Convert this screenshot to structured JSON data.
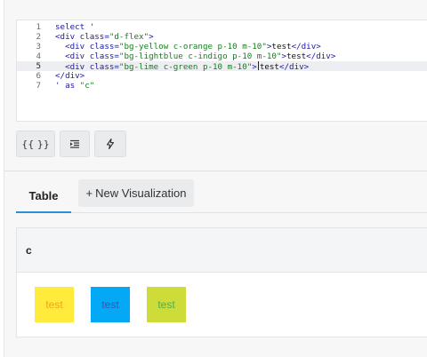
{
  "editor": {
    "lines": [
      {
        "num": "1",
        "parts": [
          {
            "c": "",
            "text": "select '"
          }
        ]
      },
      {
        "num": "2",
        "parts": [
          {
            "c": "",
            "text": "<div class="
          },
          {
            "c": "s",
            "text": "\"d-flex\""
          },
          {
            "c": "",
            "text": ">"
          }
        ]
      },
      {
        "num": "3",
        "parts": [
          {
            "c": "",
            "text": "  <div class="
          },
          {
            "c": "s",
            "text": "\"bg-yellow c-orange p-10 m-10\""
          },
          {
            "c": "",
            "text": ">"
          },
          {
            "c": "t",
            "text": "test"
          },
          {
            "c": "",
            "text": "</div>"
          }
        ]
      },
      {
        "num": "4",
        "parts": [
          {
            "c": "",
            "text": "  <div class="
          },
          {
            "c": "s",
            "text": "\"bg-lightblue c-indigo p-10 m-10\""
          },
          {
            "c": "",
            "text": ">"
          },
          {
            "c": "t",
            "text": "test"
          },
          {
            "c": "",
            "text": "</div>"
          }
        ]
      },
      {
        "num": "5",
        "parts": [
          {
            "c": "",
            "text": "  <div class="
          },
          {
            "c": "s",
            "text": "\"bg-lime c-green p-10 m-10\""
          },
          {
            "c": "",
            "text": ">"
          },
          {
            "c": "cursor",
            "text": ""
          },
          {
            "c": "t",
            "text": "test"
          },
          {
            "c": "",
            "text": "</div>"
          }
        ]
      },
      {
        "num": "6",
        "parts": [
          {
            "c": "",
            "text": "</div>"
          }
        ]
      },
      {
        "num": "7",
        "parts": [
          {
            "c": "",
            "text": "' as "
          },
          {
            "c": "s",
            "text": "\"c\""
          }
        ]
      }
    ],
    "active_line": 5
  },
  "toolbar": {
    "format_label": "{{ }}",
    "indent_icon": "indent-icon",
    "run_icon": "lightning-icon"
  },
  "tabs": {
    "table_label": "Table",
    "new_viz_plus": "+",
    "new_viz_label": "New Visualization"
  },
  "result": {
    "column": "c",
    "chips": [
      {
        "text": "test",
        "bg": "#ffeb3b",
        "fg": "#f4a21a"
      },
      {
        "text": "test",
        "bg": "#03a9f4",
        "fg": "#3f51b5"
      },
      {
        "text": "test",
        "bg": "#cddc39",
        "fg": "#4caf50"
      }
    ]
  },
  "colors": {
    "accent": "#2b8fd8",
    "code_keyword": "#1a1a9e",
    "code_string": "#14801f"
  }
}
